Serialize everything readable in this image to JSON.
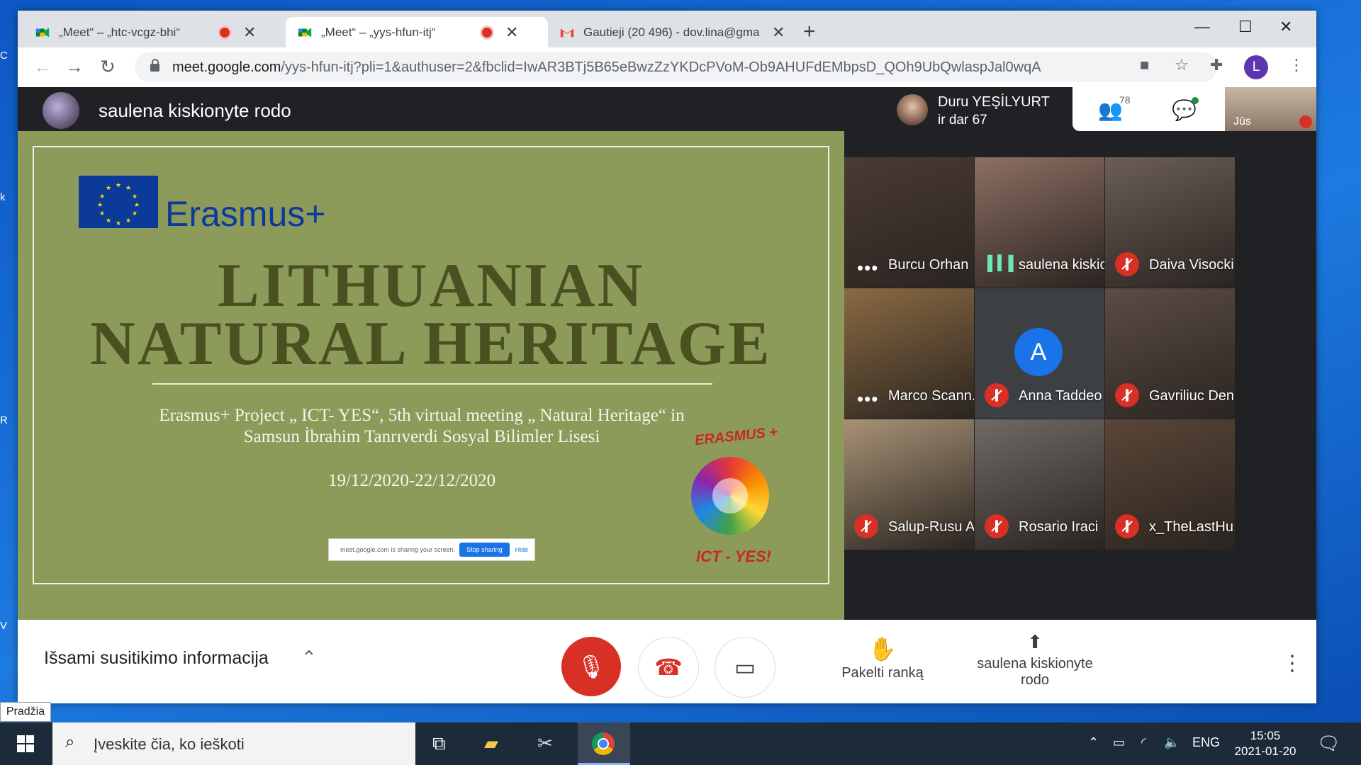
{
  "tabs": [
    {
      "title": "„Meet“ – „htc-vcgz-bhi“",
      "recording": true
    },
    {
      "title": "„Meet“ – „yys-hfun-itj“",
      "recording": true,
      "active": true
    },
    {
      "title": "Gautieji (20 496) - dov.lina@gma",
      "recording": false
    }
  ],
  "address_bar": {
    "domain": "meet.google.com",
    "path": "/yys-hfun-itj?pli=1&authuser=2&fbclid=IwAR3BTj5B65eBwzZzYKDcPVoM-Ob9AHUFdEMbpsD_QOh9UbQwlaspJal0wqA"
  },
  "profile_initial": "L",
  "presenter": {
    "name": "saulena kiskionyte rodo"
  },
  "slide": {
    "erasmus_word": "Erasmus+",
    "title_line1": "LITHUANIAN",
    "title_line2": "NATURAL HERITAGE",
    "subtitle_line1": "Erasmus+ Project „ ICT- YES“, 5th  virtual  meeting „ Natural Heritage“ in",
    "subtitle_line2": "Samsun İbrahim Tanrıverdi Sosyal Bilimler Lisesi",
    "dates": "19/12/2020-22/12/2020",
    "share_notice": "meet.google.com is sharing your screen.",
    "stop_sharing": "Stop sharing",
    "hide": "Hide",
    "logo_top": "ERASMUS +",
    "logo_bottom": "ICT - YES!"
  },
  "active_speaker": {
    "name": "Duru YEŞİLYURT",
    "subtitle": "ir dar 67"
  },
  "participants_count": "78",
  "self_view_label": "Jūs",
  "tiles": [
    {
      "name": "Burcu Orhan",
      "state": "dots",
      "bg": "#4a3b33"
    },
    {
      "name": "saulena kiskio...",
      "state": "speaking",
      "bg": "#8d6f63"
    },
    {
      "name": "Daiva Visocki...",
      "state": "muted",
      "bg": "#6b5e57"
    },
    {
      "name": "Marco Scann...",
      "state": "dots",
      "bg": "#8a6a42"
    },
    {
      "name": "Anna Taddeo",
      "state": "muted",
      "bg": "#3c4043",
      "avatar": "A"
    },
    {
      "name": "Gavriliuc Deni...",
      "state": "muted",
      "bg": "#5c4d45"
    },
    {
      "name": "Salup-Rusu Al...",
      "state": "muted",
      "bg": "#a89276"
    },
    {
      "name": "Rosario Iraci",
      "state": "muted",
      "bg": "#6f6a66"
    },
    {
      "name": "x_TheLastHu...",
      "state": "muted",
      "bg": "#5a4637"
    }
  ],
  "controls": {
    "details": "Išsami susitikimo informacija",
    "raise_hand": "Pakelti ranką",
    "presenting_line1": "saulena kiskionyte",
    "presenting_line2": "rodo"
  },
  "tooltip": "Pradžia",
  "taskbar": {
    "search_placeholder": "Įveskite čia, ko ieškoti",
    "lang": "ENG",
    "time": "15:05",
    "date": "2021-01-20"
  }
}
